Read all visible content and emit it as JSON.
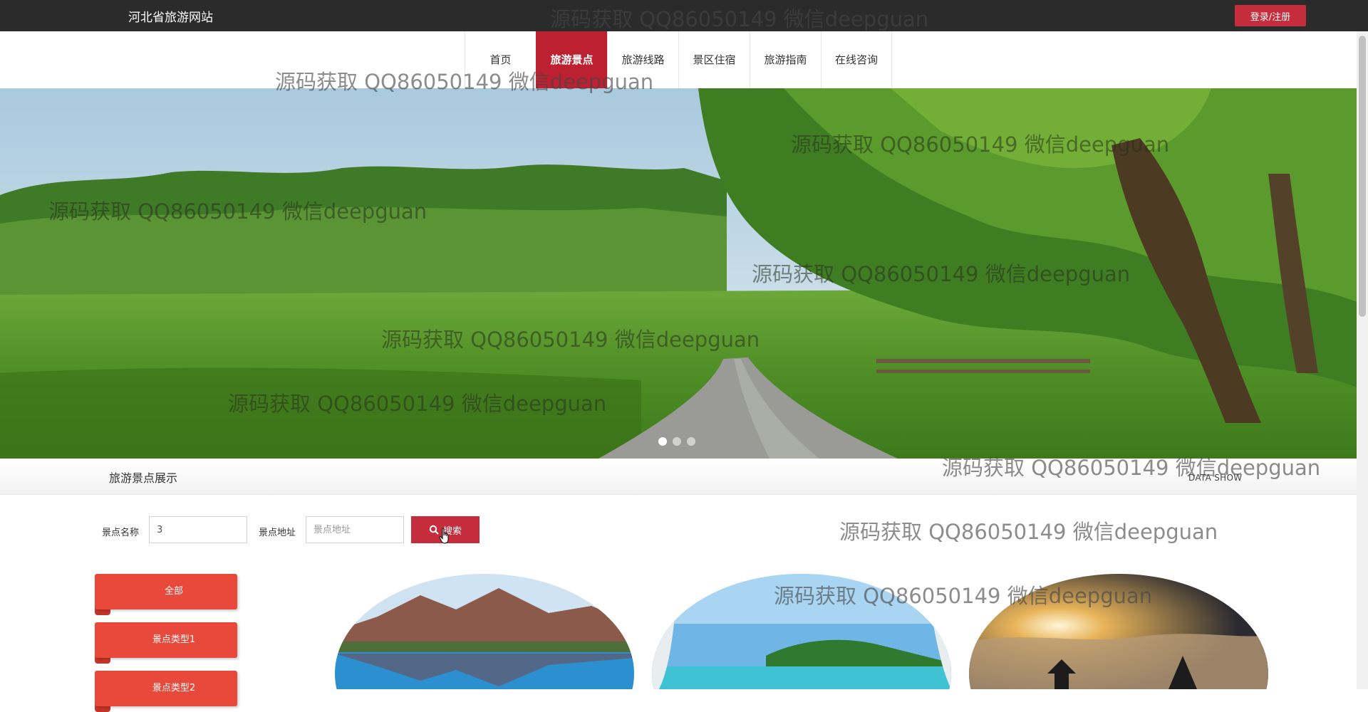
{
  "header": {
    "site_title": "河北省旅游网站",
    "login_label": "登录/注册"
  },
  "nav": {
    "items": [
      {
        "label": "首页",
        "active": false
      },
      {
        "label": "旅游景点",
        "active": true
      },
      {
        "label": "旅游线路",
        "active": false
      },
      {
        "label": "景区住宿",
        "active": false
      },
      {
        "label": "旅游指南",
        "active": false
      },
      {
        "label": "在线咨询",
        "active": false
      }
    ]
  },
  "banner": {
    "image": "green-field-road-trees",
    "slide_count": 3,
    "active_slide": 1
  },
  "section": {
    "title": "旅游景点展示",
    "subtitle": "DATA SHOW"
  },
  "search": {
    "name_label": "景点名称",
    "name_value": "3",
    "address_label": "景点地址",
    "address_placeholder": "景点地址",
    "button_label": "搜索"
  },
  "categories": [
    "全部",
    "景点类型1",
    "景点类型2"
  ],
  "spots": [
    {
      "image": "lake-mountain"
    },
    {
      "image": "beach-island"
    },
    {
      "image": "sunrise-sea-of-clouds"
    }
  ],
  "watermark": {
    "text": "源码获取 QQ86050149 微信deepguan"
  },
  "colors": {
    "topbar": "#2b2b2b",
    "accent": "#c52d3d",
    "nav_active": "#bd2030",
    "category": "#e8493a"
  }
}
